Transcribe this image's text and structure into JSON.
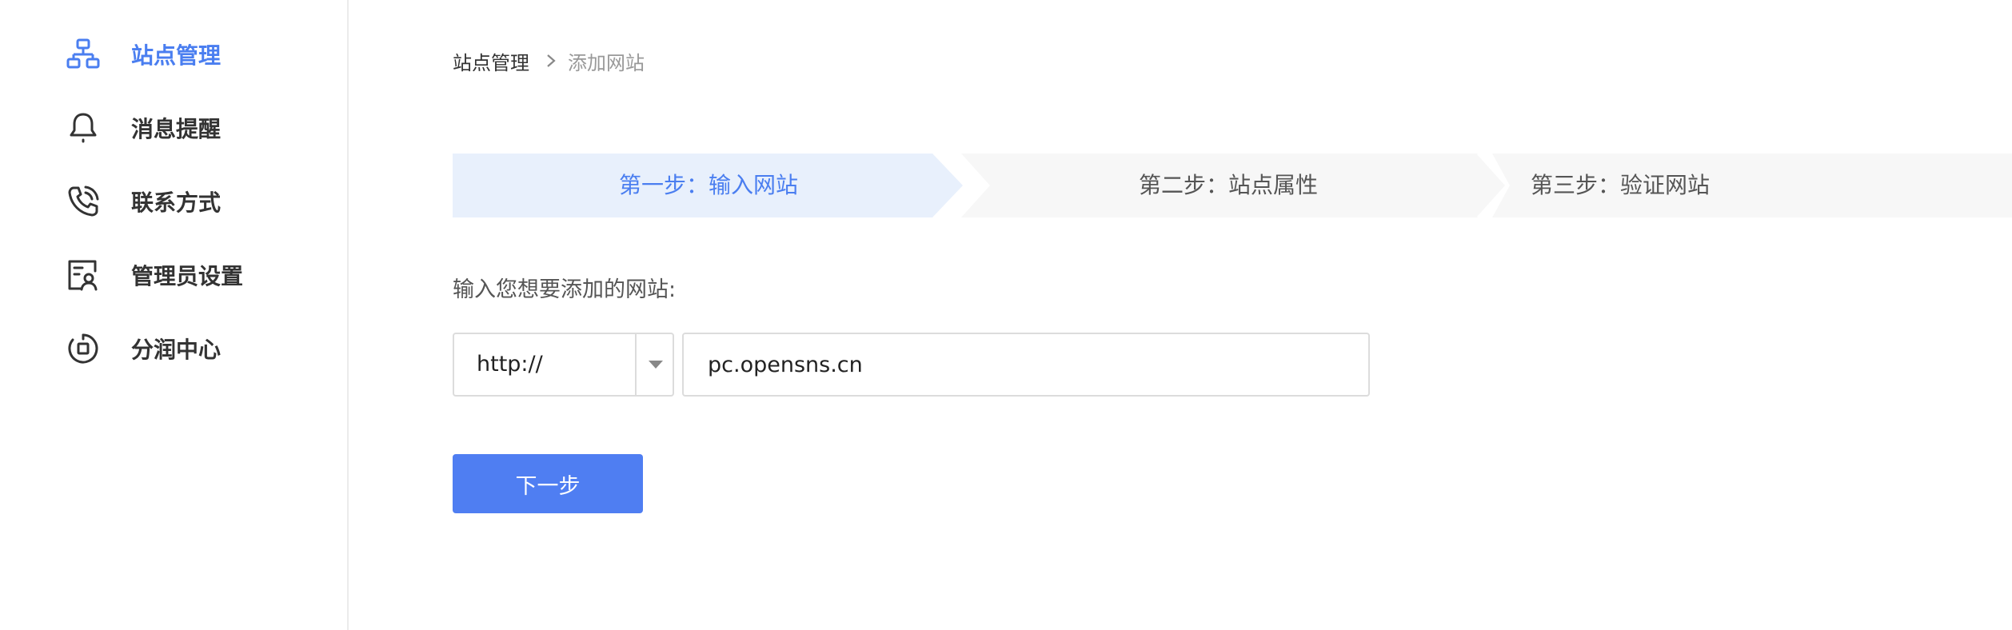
{
  "sidebar": {
    "items": [
      {
        "label": "站点管理",
        "icon": "sitemap-icon",
        "active": true
      },
      {
        "label": "消息提醒",
        "icon": "bell-icon",
        "active": false
      },
      {
        "label": "联系方式",
        "icon": "phone-icon",
        "active": false
      },
      {
        "label": "管理员设置",
        "icon": "admin-user-icon",
        "active": false
      },
      {
        "label": "分润中心",
        "icon": "profit-share-icon",
        "active": false
      }
    ]
  },
  "breadcrumb": {
    "parent": "站点管理",
    "current": "添加网站"
  },
  "steps": [
    {
      "label": "第一步：输入网站",
      "active": true
    },
    {
      "label": "第二步：站点属性",
      "active": false
    },
    {
      "label": "第三步：验证网站",
      "active": false
    }
  ],
  "form": {
    "prompt": "输入您想要添加的网站:",
    "protocol_value": "http://",
    "url_value": "pc.opensns.cn",
    "next_label": "下一步"
  },
  "colors": {
    "accent": "#4f7ef2",
    "active_step_bg": "#e8f0fc",
    "inactive_step_bg": "#f7f7f7"
  }
}
